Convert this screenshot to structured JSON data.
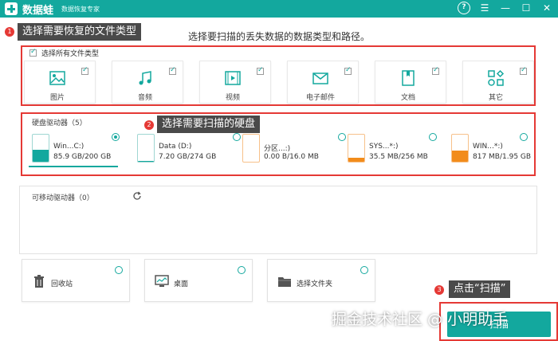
{
  "app": {
    "name": "数据蛙",
    "subtitle": "数据恢复专家"
  },
  "window_controls": {
    "help": "?",
    "menu": "☰",
    "minimize": "—",
    "maximize": "☐",
    "close": "✕"
  },
  "annotations": [
    {
      "num": "1",
      "text": "选择需要恢复的文件类型"
    },
    {
      "num": "2",
      "text": "选择需要扫描的硬盘"
    },
    {
      "num": "3",
      "text": "点击“扫描”"
    }
  ],
  "heading": "选择要扫描的丢失数据的数据类型和路径。",
  "file_types": {
    "select_all_label": "选择所有文件类型",
    "items": [
      {
        "label": "图片",
        "icon": "image-icon",
        "checked": true
      },
      {
        "label": "音频",
        "icon": "music-icon",
        "checked": true
      },
      {
        "label": "视频",
        "icon": "video-icon",
        "checked": true
      },
      {
        "label": "电子邮件",
        "icon": "email-icon",
        "checked": true
      },
      {
        "label": "文档",
        "icon": "document-icon",
        "checked": true
      },
      {
        "label": "其它",
        "icon": "other-icon",
        "checked": true
      }
    ]
  },
  "drives": {
    "title": "硬盘驱动器（5）",
    "items": [
      {
        "name": "Win...C:)",
        "size": "85.9 GB/200 GB",
        "used_fraction": 0.43,
        "color": "#13a89e",
        "selected": true
      },
      {
        "name": "Data (D:)",
        "size": "7.20 GB/274 GB",
        "used_fraction": 0.03,
        "color": "#13a89e",
        "selected": false
      },
      {
        "name": "分区...:)",
        "size": "0.00  B/16.0 MB",
        "used_fraction": 0.0,
        "color": "#f28c1b",
        "selected": false
      },
      {
        "name": "SYS...*:)",
        "size": "35.5 MB/256 MB",
        "used_fraction": 0.14,
        "color": "#f28c1b",
        "selected": false
      },
      {
        "name": "WIN...*:)",
        "size": "817 MB/1.95 GB",
        "used_fraction": 0.42,
        "color": "#f28c1b",
        "selected": false
      }
    ]
  },
  "removable": {
    "title": "可移动驱动器（0）"
  },
  "locations": [
    {
      "label": "回收站",
      "icon": "trash-icon"
    },
    {
      "label": "桌面",
      "icon": "desktop-icon"
    },
    {
      "label": "选择文件夹",
      "icon": "folder-icon"
    }
  ],
  "scan_button": "扫描",
  "watermark": "掘金技术社区 @ 小明助手",
  "colors": {
    "accent": "#13a89e",
    "annotation": "#e53935",
    "orange": "#f28c1b"
  }
}
